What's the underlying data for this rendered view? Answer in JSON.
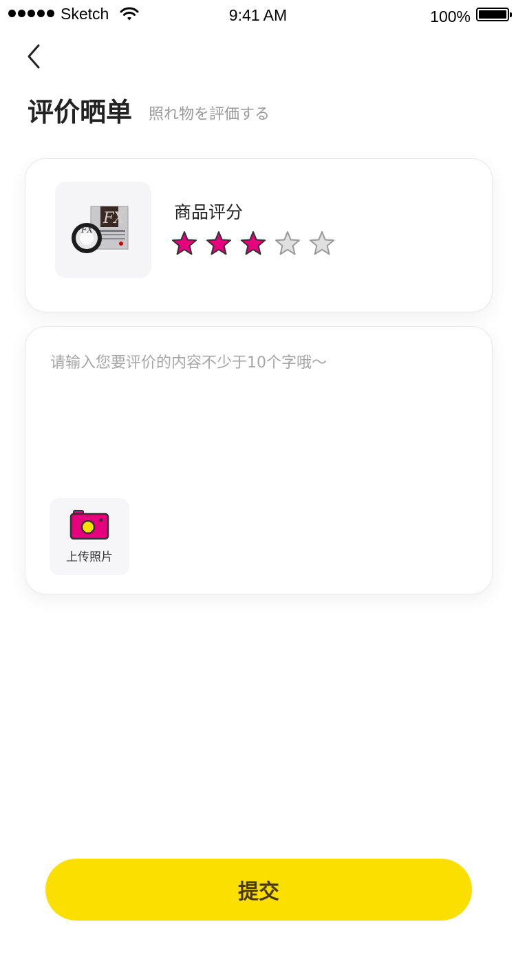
{
  "status_bar": {
    "carrier": "Sketch",
    "time": "9:41 AM",
    "battery": "100%"
  },
  "header": {
    "title": "评价晒单",
    "subtitle": "照れ物を評価する"
  },
  "product": {
    "rating_label": "商品评分",
    "rating": 3,
    "max_rating": 5,
    "star_filled_color": "#e6007e",
    "star_empty_color": "#e0e0e0",
    "image_icon": "product-eye-drops-image"
  },
  "review": {
    "placeholder": "请输入您要评价的内容不少于10个字哦～",
    "upload_label": "上传照片",
    "upload_icon": "camera-icon",
    "camera_color": "#e6007e",
    "lens_color": "#fbdf00"
  },
  "submit": {
    "label": "提交",
    "color": "#fbdf00"
  }
}
